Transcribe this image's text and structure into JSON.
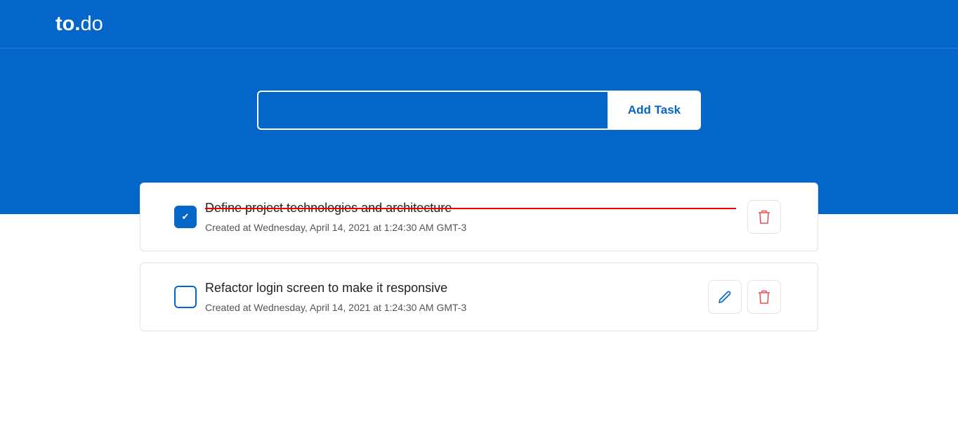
{
  "header": {
    "logo_bold": "to.",
    "logo_light": "do"
  },
  "form": {
    "input_value": "",
    "placeholder": "",
    "add_label": "Add Task"
  },
  "tasks": [
    {
      "title": "Define project technologies and architecture",
      "created": "Created at Wednesday, April 14, 2021 at 1:24:30 AM GMT-3",
      "completed": true
    },
    {
      "title": "Refactor login screen to make it responsive",
      "created": "Created at Wednesday, April 14, 2021 at 1:24:30 AM GMT-3",
      "completed": false
    }
  ],
  "colors": {
    "brand": "#0466c8",
    "danger": "#e55353",
    "strike": "#ee0000"
  }
}
